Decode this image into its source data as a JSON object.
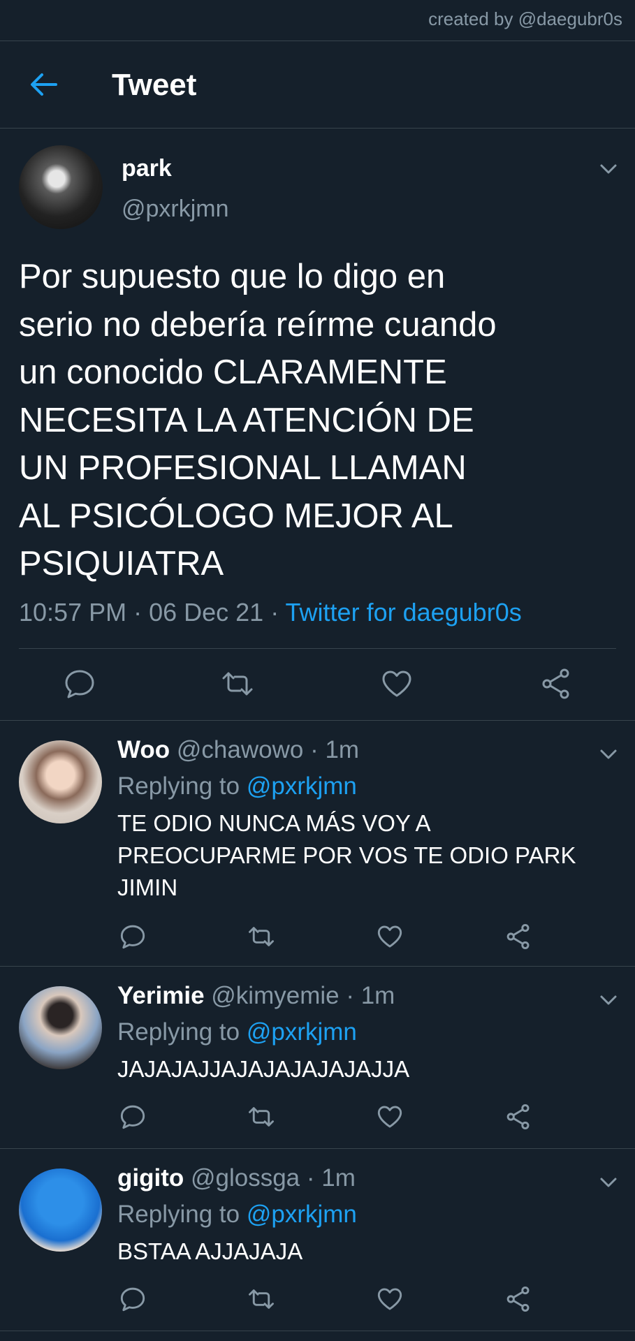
{
  "watermark": "created by @daegubr0s",
  "header": {
    "title": "Tweet"
  },
  "tweet": {
    "name": "park",
    "handle": "@pxrkjmn",
    "text": "Por supuesto que lo digo en\nserio no debería reírme cuando\nun conocido CLARAMENTE\nNECESITA LA ATENCIÓN DE\nUN PROFESIONAL LLAMAN\nAL PSICÓLOGO MEJOR AL\nPSIQUIATRA",
    "time": "10:57 PM · 06 Dec 21 · ",
    "client": "Twitter for daegubr0s"
  },
  "replies": [
    {
      "name": "Woo",
      "handle": "@chawowo · 1m",
      "replying_prefix": "Replying to ",
      "replying_to": "@pxrkjmn",
      "text": "TE ODIO NUNCA MÁS VOY A PREOCUPARME POR VOS TE ODIO PARK JIMIN"
    },
    {
      "name": "Yerimie",
      "handle": "@kimyemie · 1m",
      "replying_prefix": "Replying to ",
      "replying_to": "@pxrkjmn",
      "text": "JAJAJAJJAJAJAJAJAJAJJA"
    },
    {
      "name": "gigito",
      "handle": "@glossga · 1m",
      "replying_prefix": "Replying to ",
      "replying_to": "@pxrkjmn",
      "text": "BSTAA AJJAJAJA"
    }
  ],
  "colors": {
    "background": "#15202b",
    "accent": "#1da1f2",
    "muted": "#8899a6",
    "divider": "#38444d"
  },
  "icons": [
    "back-arrow-icon",
    "chevron-down-icon",
    "reply-icon",
    "retweet-icon",
    "like-icon",
    "share-icon"
  ]
}
